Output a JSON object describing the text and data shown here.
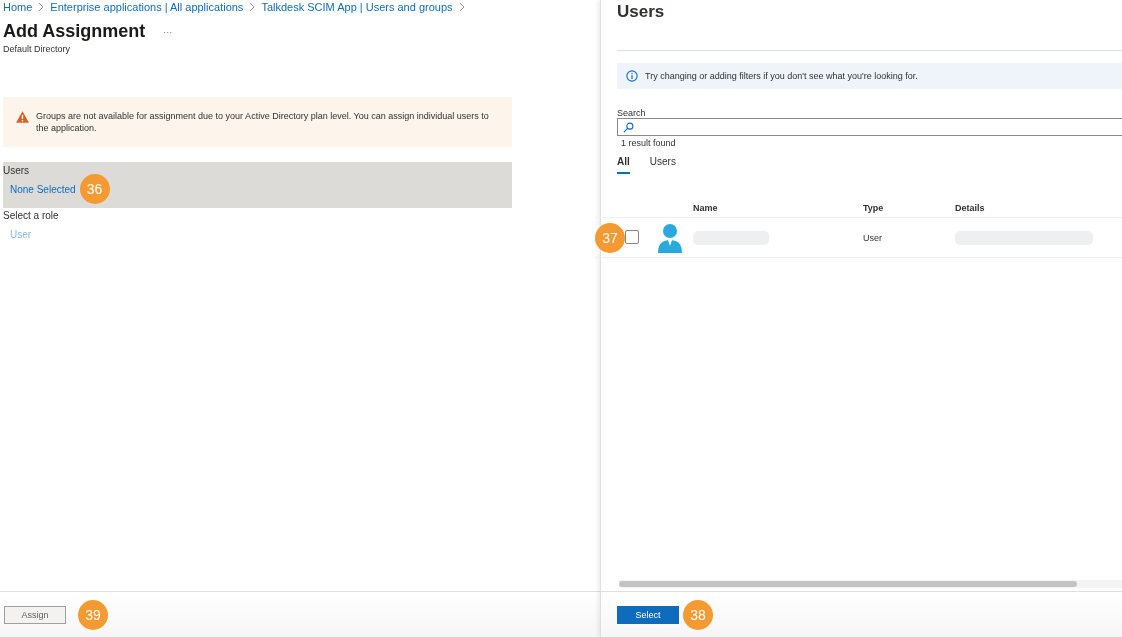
{
  "breadcrumb": [
    "Home",
    "Enterprise applications | All applications",
    "Talkdesk SCIM App | Users and groups"
  ],
  "page": {
    "title": "Add Assignment",
    "more": "···",
    "subtitle": "Default Directory"
  },
  "warning": {
    "text": "Groups are not available for assignment due to your Active Directory plan level. You can assign individual users to the application."
  },
  "users_field": {
    "label": "Users",
    "value": "None Selected",
    "badge": "36",
    "selected": true
  },
  "role": {
    "label": "Select a role",
    "value": "User"
  },
  "assign": {
    "label": "Assign",
    "disabled": true,
    "badge": "39"
  },
  "panel": {
    "title": "Users",
    "info": "Try changing or adding filters if you don't see what you're looking for.",
    "search": {
      "label": "Search",
      "result": "1 result found"
    },
    "tabs": [
      {
        "label": "All",
        "selected": true
      },
      {
        "label": "Users",
        "selected": false
      }
    ],
    "columns": [
      "Name",
      "Type",
      "Details"
    ],
    "rows": [
      {
        "type": "User",
        "checked": false,
        "badge": "37"
      }
    ],
    "select": {
      "label": "Select",
      "badge": "38"
    }
  }
}
